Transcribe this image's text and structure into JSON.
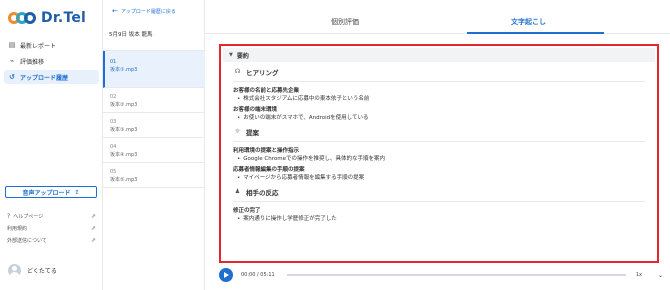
{
  "app": {
    "name": "Dr.Tel"
  },
  "nav": [
    {
      "label": "最新レポート",
      "icon": "report-icon",
      "active": false
    },
    {
      "label": "評価推移",
      "icon": "chart-icon",
      "active": false
    },
    {
      "label": "アップロード履歴",
      "icon": "history-icon",
      "active": true
    }
  ],
  "upload_button": "音声アップロード",
  "links": [
    {
      "label": "ヘルプページ",
      "icon": "help-icon"
    },
    {
      "label": "利用規約"
    },
    {
      "label": "外部送信について"
    }
  ],
  "user": {
    "name": "どくたてる"
  },
  "history": {
    "back_label": "アップロード履歴に戻る",
    "title": "5月9日 坂本 龍馬",
    "items": [
      {
        "num": "01",
        "file": "坂本①.mp3"
      },
      {
        "num": "02",
        "file": "坂本②.mp3"
      },
      {
        "num": "03",
        "file": "坂本③.mp3"
      },
      {
        "num": "04",
        "file": "坂本④.mp3"
      },
      {
        "num": "05",
        "file": "坂本⑤.mp3"
      }
    ]
  },
  "tabs": {
    "individual": "個別評価",
    "transcript": "文字起こし"
  },
  "summary": {
    "header": "要約",
    "sections": [
      {
        "title": "ヒアリング",
        "icon": "hearing-icon",
        "groups": [
          {
            "heading": "お客様の名前と応募先企業",
            "bullets": [
              "株式会社スタジアムに応募中の東本依子という名前"
            ]
          },
          {
            "heading": "お客様の端末環境",
            "bullets": [
              "お使いの端末がスマホで、Androidを使用している"
            ]
          }
        ]
      },
      {
        "title": "提案",
        "icon": "lightbulb-icon",
        "groups": [
          {
            "heading": "利用環境の提案と操作指示",
            "bullets": [
              "Google Chromeでの操作を推奨し、具体的な手順を案内"
            ]
          },
          {
            "heading": "応募者情報編集の手順の提案",
            "bullets": [
              "マイページから応募者情報を編集する手順の提案"
            ]
          }
        ]
      },
      {
        "title": "相手の反応",
        "icon": "person-icon",
        "groups": [
          {
            "heading": "修正の完了",
            "bullets": [
              "案内通りに操作し学歴修正が完了した"
            ]
          }
        ]
      }
    ]
  },
  "player": {
    "time": "00:00 / 05:11",
    "speed": "1x"
  }
}
